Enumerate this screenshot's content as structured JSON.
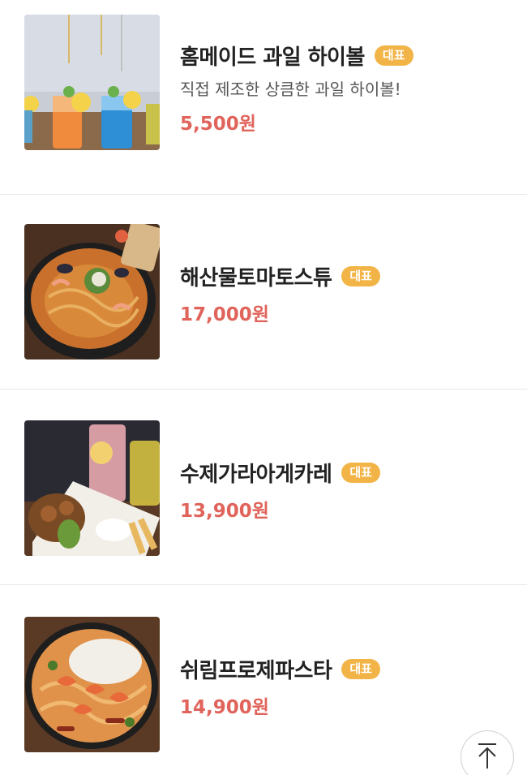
{
  "menu": {
    "items": [
      {
        "name": "홈메이드 과일 하이볼",
        "badge": "대표",
        "description": "직접 제조한 상큼한 과일 하이볼!",
        "price": "5,500원"
      },
      {
        "name": "해산물토마토스튜",
        "badge": "대표",
        "price": "17,000원"
      },
      {
        "name": "수제가라아게카레",
        "badge": "대표",
        "price": "13,900원"
      },
      {
        "name": "쉬림프로제파스타",
        "badge": "대표",
        "price": "14,900원"
      }
    ]
  },
  "colors": {
    "badge_bg": "#f2b447",
    "price": "#e0645b",
    "divider": "#e8e8e8"
  },
  "icons": {
    "scroll_top": "arrow-up-to-top-icon"
  }
}
